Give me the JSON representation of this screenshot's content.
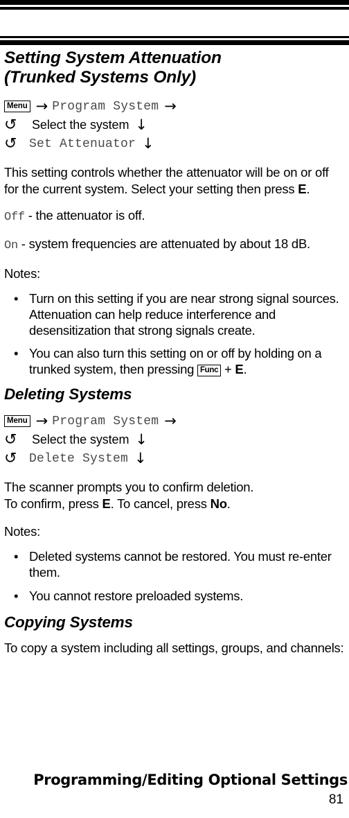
{
  "document": {
    "page_number": "81",
    "footer_title": "Programming/Editing Optional Settings"
  },
  "sections": [
    {
      "id": "setting-system-attenuation",
      "title_line1": "Setting System Attenuation",
      "title_line2": "(Trunked Systems Only)",
      "keypath": {
        "row1": {
          "key": "Menu",
          "arrow_right_1": "→",
          "menu_item": "Program System",
          "arrow_right_2": "→"
        },
        "row2": {
          "rotate_icon": "↺",
          "text": "Select the system",
          "arrow_down": "↓"
        },
        "row3": {
          "rotate_icon": "↺",
          "text": "Set Attenuator",
          "arrow_down": "↓"
        }
      },
      "paragraphs": [
        "This setting controls whether the attenuator will be on or off for the current system. Select your setting then press ",
        "."
      ],
      "paragraph_bold": "E",
      "option_off_label": "Off",
      "option_off_text": " - the attenuator is off.",
      "option_on_label": "On",
      "option_on_text": " - system frequencies are attenuated by about 18 dB.",
      "notes_label": "Notes:",
      "notes": [
        {
          "text": "Turn on this setting if you are near strong signal sources. Attenuation can help reduce interference and desensitization that strong signals create."
        },
        {
          "text_before": "You can also turn this setting on or off by holding on a trunked system, then pressing ",
          "key": "Func",
          "text_plus": " +  ",
          "key_bold": "E",
          "text_after": "."
        }
      ]
    },
    {
      "id": "deleting-systems",
      "title": "Deleting Systems",
      "keypath": {
        "row1": {
          "key": "Menu",
          "arrow_right_1": "→",
          "menu_item": "Program System",
          "arrow_right_2": "→"
        },
        "row2": {
          "rotate_icon": "↺",
          "text": "Select the system",
          "arrow_down": "↓"
        },
        "row3": {
          "rotate_icon": "↺",
          "text": "Delete System",
          "arrow_down": "↓"
        }
      },
      "paragraph_line1": "The scanner prompts you to confirm deletion.",
      "paragraph_line2_a": "To confirm, press ",
      "paragraph_line2_bold1": "E",
      "paragraph_line2_b": ". To cancel, press ",
      "paragraph_line2_bold2": "No",
      "paragraph_line2_c": ".",
      "notes_label": "Notes:",
      "notes": [
        {
          "text": "Deleted systems cannot be restored. You must re-enter them."
        },
        {
          "text": "You cannot restore preloaded systems."
        }
      ]
    },
    {
      "id": "copying-systems",
      "title": "Copying Systems",
      "paragraph": "To copy a system including all settings, groups, and channels:"
    }
  ]
}
